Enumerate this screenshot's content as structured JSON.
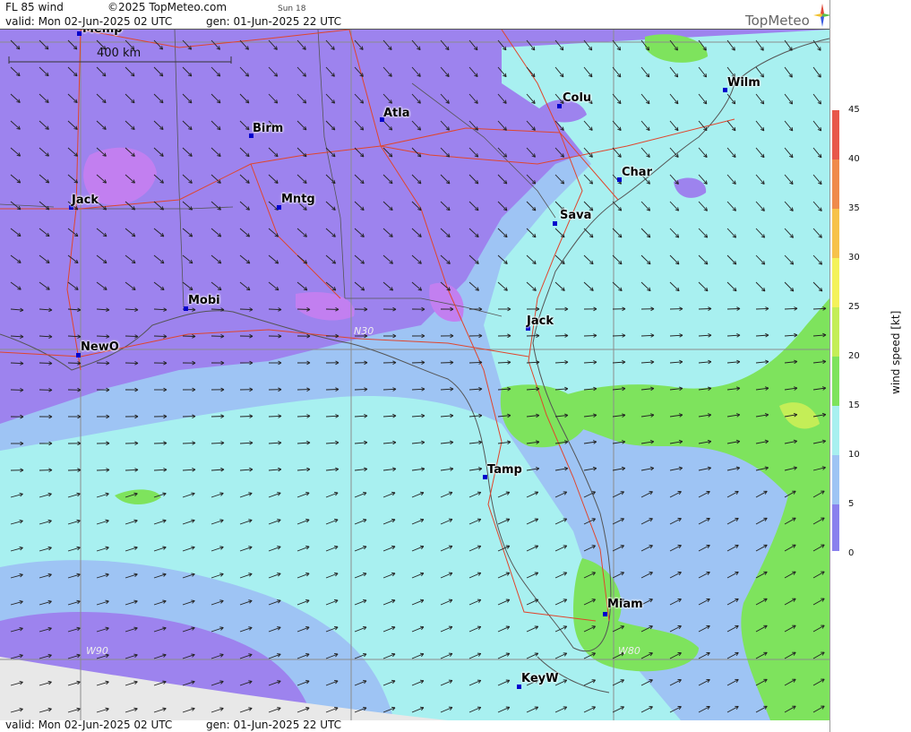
{
  "header": {
    "product": "FL 85 wind",
    "copyright": "©2025 TopMeteo.com",
    "small_label": "Sun 18",
    "valid": "valid:  Mon  02-Jun-2025  02 UTC",
    "generated": "gen: 01-Jun-2025 22 UTC"
  },
  "footer": {
    "valid": "valid:  Mon  02-Jun-2025  02 UTC",
    "generated": "gen: 01-Jun-2025 22 UTC"
  },
  "logo": {
    "text": "TopMeteo",
    "icon": "compass-star-icon"
  },
  "scale_bar": {
    "label": "400 km"
  },
  "meridians": [
    {
      "label": "W90"
    },
    {
      "label": "W80"
    },
    {
      "label": "N30"
    }
  ],
  "cities": [
    {
      "name": "Memp"
    },
    {
      "name": "Atla"
    },
    {
      "name": "Colu"
    },
    {
      "name": "Wilm"
    },
    {
      "name": "Birm"
    },
    {
      "name": "Char"
    },
    {
      "name": "Jack"
    },
    {
      "name": "Mntg"
    },
    {
      "name": "Sava"
    },
    {
      "name": "Mobi"
    },
    {
      "name": "Jack"
    },
    {
      "name": "NewO"
    },
    {
      "name": "Tamp"
    },
    {
      "name": "Miam"
    },
    {
      "name": "KeyW"
    }
  ],
  "legend": {
    "unit_label": "wind speed [kt]",
    "ticks": [
      "45",
      "40",
      "35",
      "30",
      "25",
      "20",
      "15",
      "10",
      "5",
      "0"
    ],
    "colors": [
      "#e8574a",
      "#f08a4b",
      "#f7c24a",
      "#f4f25a",
      "#c4ee57",
      "#7ee35d",
      "#a8f0f0",
      "#9ec4f4",
      "#8a80ee",
      "#c27ff0"
    ]
  },
  "palette": {
    "violet": "#9d83ee",
    "purple_hi": "#c27ff0",
    "blue": "#9ec4f4",
    "cyan": "#a8f0f0",
    "green": "#7ee35d",
    "sea_grey": "#e8e8e8",
    "road": "#e0452c",
    "coast": "#555555"
  }
}
